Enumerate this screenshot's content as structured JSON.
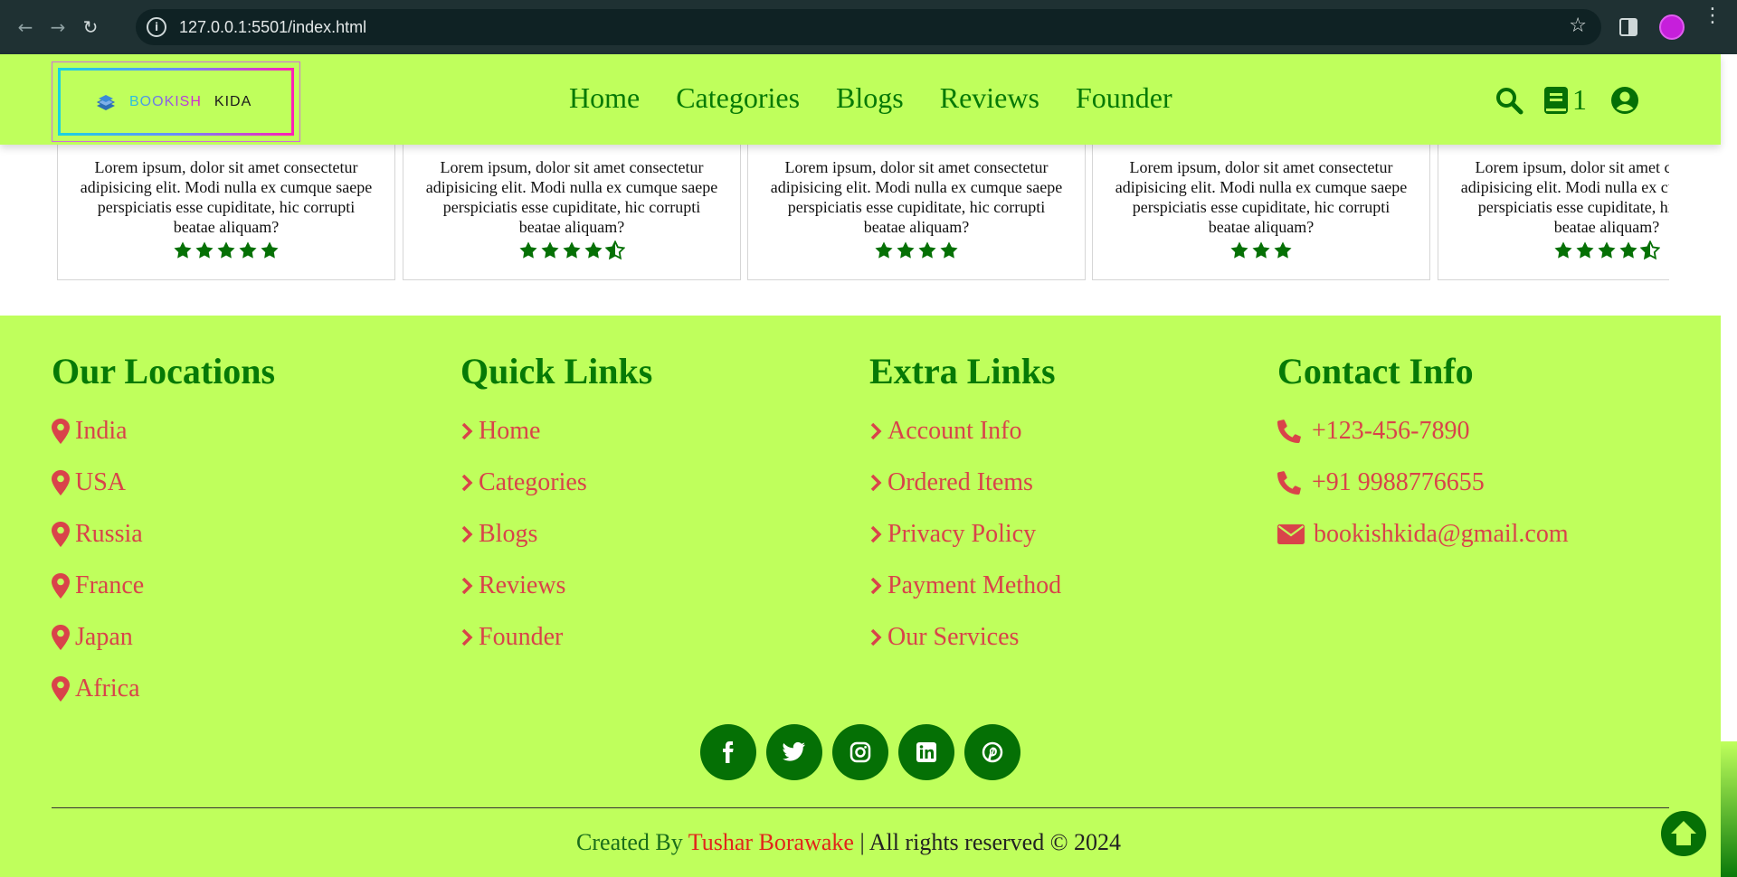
{
  "browser": {
    "url": "127.0.0.1:5501/index.html"
  },
  "header": {
    "logo": {
      "brand_part1": "BOOKISH",
      "brand_part2": "KIDA"
    },
    "nav": [
      "Home",
      "Categories",
      "Blogs",
      "Reviews",
      "Founder"
    ],
    "cart_count": "1"
  },
  "reviews": [
    {
      "text": "Lorem ipsum, dolor sit amet consectetur adipisicing elit. Modi nulla ex cumque saepe perspiciatis esse cupiditate, hic corrupti beatae aliquam?",
      "rating": 5
    },
    {
      "text": "Lorem ipsum, dolor sit amet consectetur adipisicing elit. Modi nulla ex cumque saepe perspiciatis esse cupiditate, hic corrupti beatae aliquam?",
      "rating": 4.5
    },
    {
      "text": "Lorem ipsum, dolor sit amet consectetur adipisicing elit. Modi nulla ex cumque saepe perspiciatis esse cupiditate, hic corrupti beatae aliquam?",
      "rating": 4
    },
    {
      "text": "Lorem ipsum, dolor sit amet consectetur adipisicing elit. Modi nulla ex cumque saepe perspiciatis esse cupiditate, hic corrupti beatae aliquam?",
      "rating": 3
    },
    {
      "text": "Lorem ipsum, dolor sit amet consectetur adipisicing elit. Modi nulla ex cumque saepe perspiciatis esse cupiditate, hic corrupti beatae aliquam?",
      "rating": 4.5
    }
  ],
  "footer": {
    "locations": {
      "title": "Our Locations",
      "items": [
        "India",
        "USA",
        "Russia",
        "France",
        "Japan",
        "Africa"
      ]
    },
    "quick_links": {
      "title": "Quick Links",
      "items": [
        "Home",
        "Categories",
        "Blogs",
        "Reviews",
        "Founder"
      ]
    },
    "extra_links": {
      "title": "Extra Links",
      "items": [
        "Account Info",
        "Ordered Items",
        "Privacy Policy",
        "Payment Method",
        "Our Services"
      ]
    },
    "contact": {
      "title": "Contact Info",
      "items": [
        {
          "icon": "phone-icon",
          "text": "+123-456-7890"
        },
        {
          "icon": "phone-icon",
          "text": "+91 9988776655"
        },
        {
          "icon": "envelope-icon",
          "text": "bookishkida@gmail.com"
        }
      ]
    },
    "socials": [
      "facebook-icon",
      "twitter-icon",
      "instagram-icon",
      "linkedin-icon",
      "pinterest-icon"
    ],
    "credit": {
      "prefix": "Created By",
      "name": "Tushar Borawake",
      "suffix": "| All rights reserved © 2024"
    }
  },
  "colors": {
    "lime_bg": "#bfff5c",
    "brand_green": "#057005",
    "link_red": "#d9434a",
    "star_green": "#057005"
  }
}
